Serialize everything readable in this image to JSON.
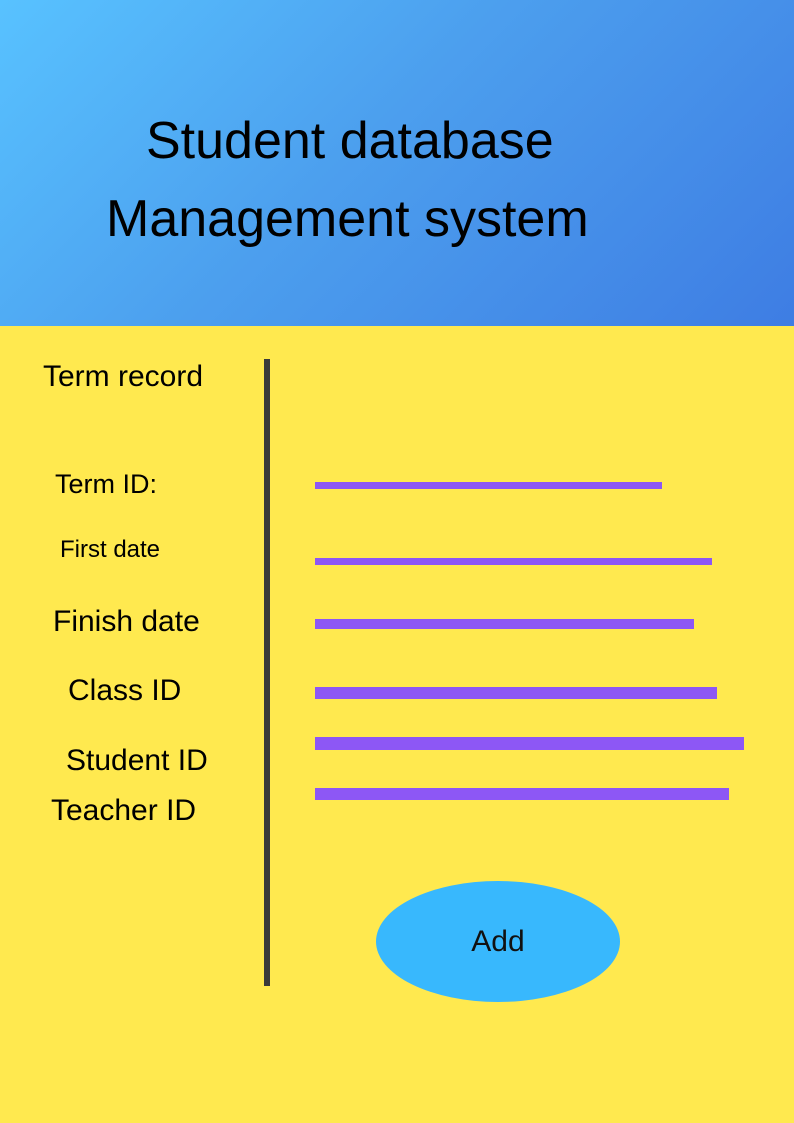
{
  "header": {
    "title_line1": "Student database",
    "title_line2": "Management system",
    "gradient_colors": [
      "#58c2ff",
      "#3e7de3"
    ]
  },
  "form": {
    "section_title": "Term record",
    "fields": [
      {
        "label": "Term ID:",
        "value": ""
      },
      {
        "label": "First date",
        "value": ""
      },
      {
        "label": "Finish date",
        "value": ""
      },
      {
        "label": "Class ID",
        "value": ""
      },
      {
        "label": "Student ID",
        "value": ""
      },
      {
        "label": "Teacher ID",
        "value": ""
      }
    ],
    "add_label": "Add"
  },
  "colors": {
    "background": "#ffe94f",
    "field_line": "#8d57f5",
    "divider": "#3a3a3a",
    "button": "#38b8fd"
  }
}
